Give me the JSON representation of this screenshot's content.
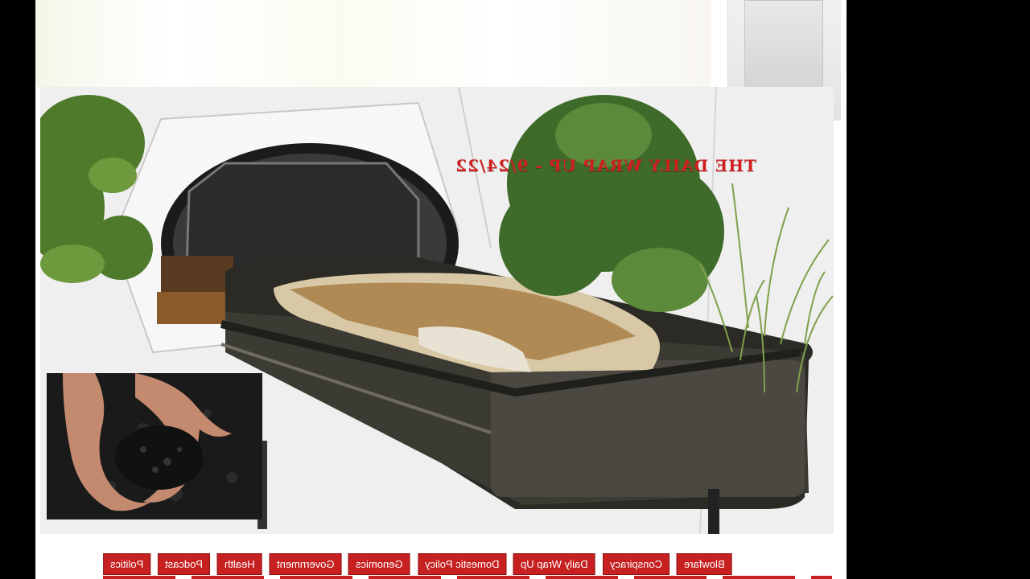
{
  "hero": {
    "title": "THE DAILY WRAP UP - 9/24/22",
    "mirrored": true
  },
  "nav": {
    "items": [
      "Blowfare",
      "Conspiracy",
      "Daily Wrap Up",
      "Domestic Policy",
      "Genomics",
      "Government",
      "Health",
      "Podcast",
      "Politics"
    ]
  },
  "colors": {
    "title_red": "#d11f1f",
    "nav_red": "#c62020",
    "background": "#000000"
  }
}
